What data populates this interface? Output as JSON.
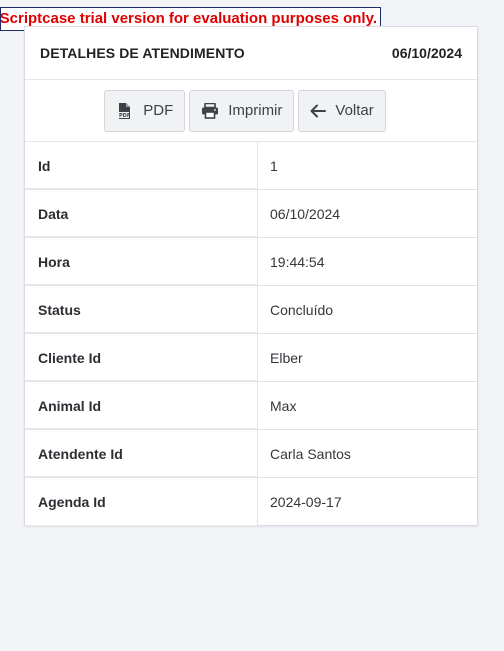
{
  "trial_banner": "y Scriptcase trial version for evaluation purposes only.",
  "header": {
    "title": "DETALHES DE ATENDIMENTO",
    "date": "06/10/2024"
  },
  "toolbar": {
    "pdf_label": "PDF",
    "pdf_icon": "file-pdf-icon",
    "print_label": "Imprimir",
    "print_icon": "printer-icon",
    "back_label": "Voltar",
    "back_icon": "arrow-left-icon"
  },
  "fields": [
    {
      "label": "Id",
      "value": "1"
    },
    {
      "label": "Data",
      "value": "06/10/2024"
    },
    {
      "label": "Hora",
      "value": "19:44:54"
    },
    {
      "label": "Status",
      "value": "Concluído"
    },
    {
      "label": "Cliente Id",
      "value": "Elber"
    },
    {
      "label": "Animal Id",
      "value": "Max"
    },
    {
      "label": "Atendente Id",
      "value": "Carla Santos"
    },
    {
      "label": "Agenda Id",
      "value": "2024-09-17"
    }
  ],
  "colors": {
    "trial_text": "#e00000",
    "page_background": "#f3f4f8"
  }
}
